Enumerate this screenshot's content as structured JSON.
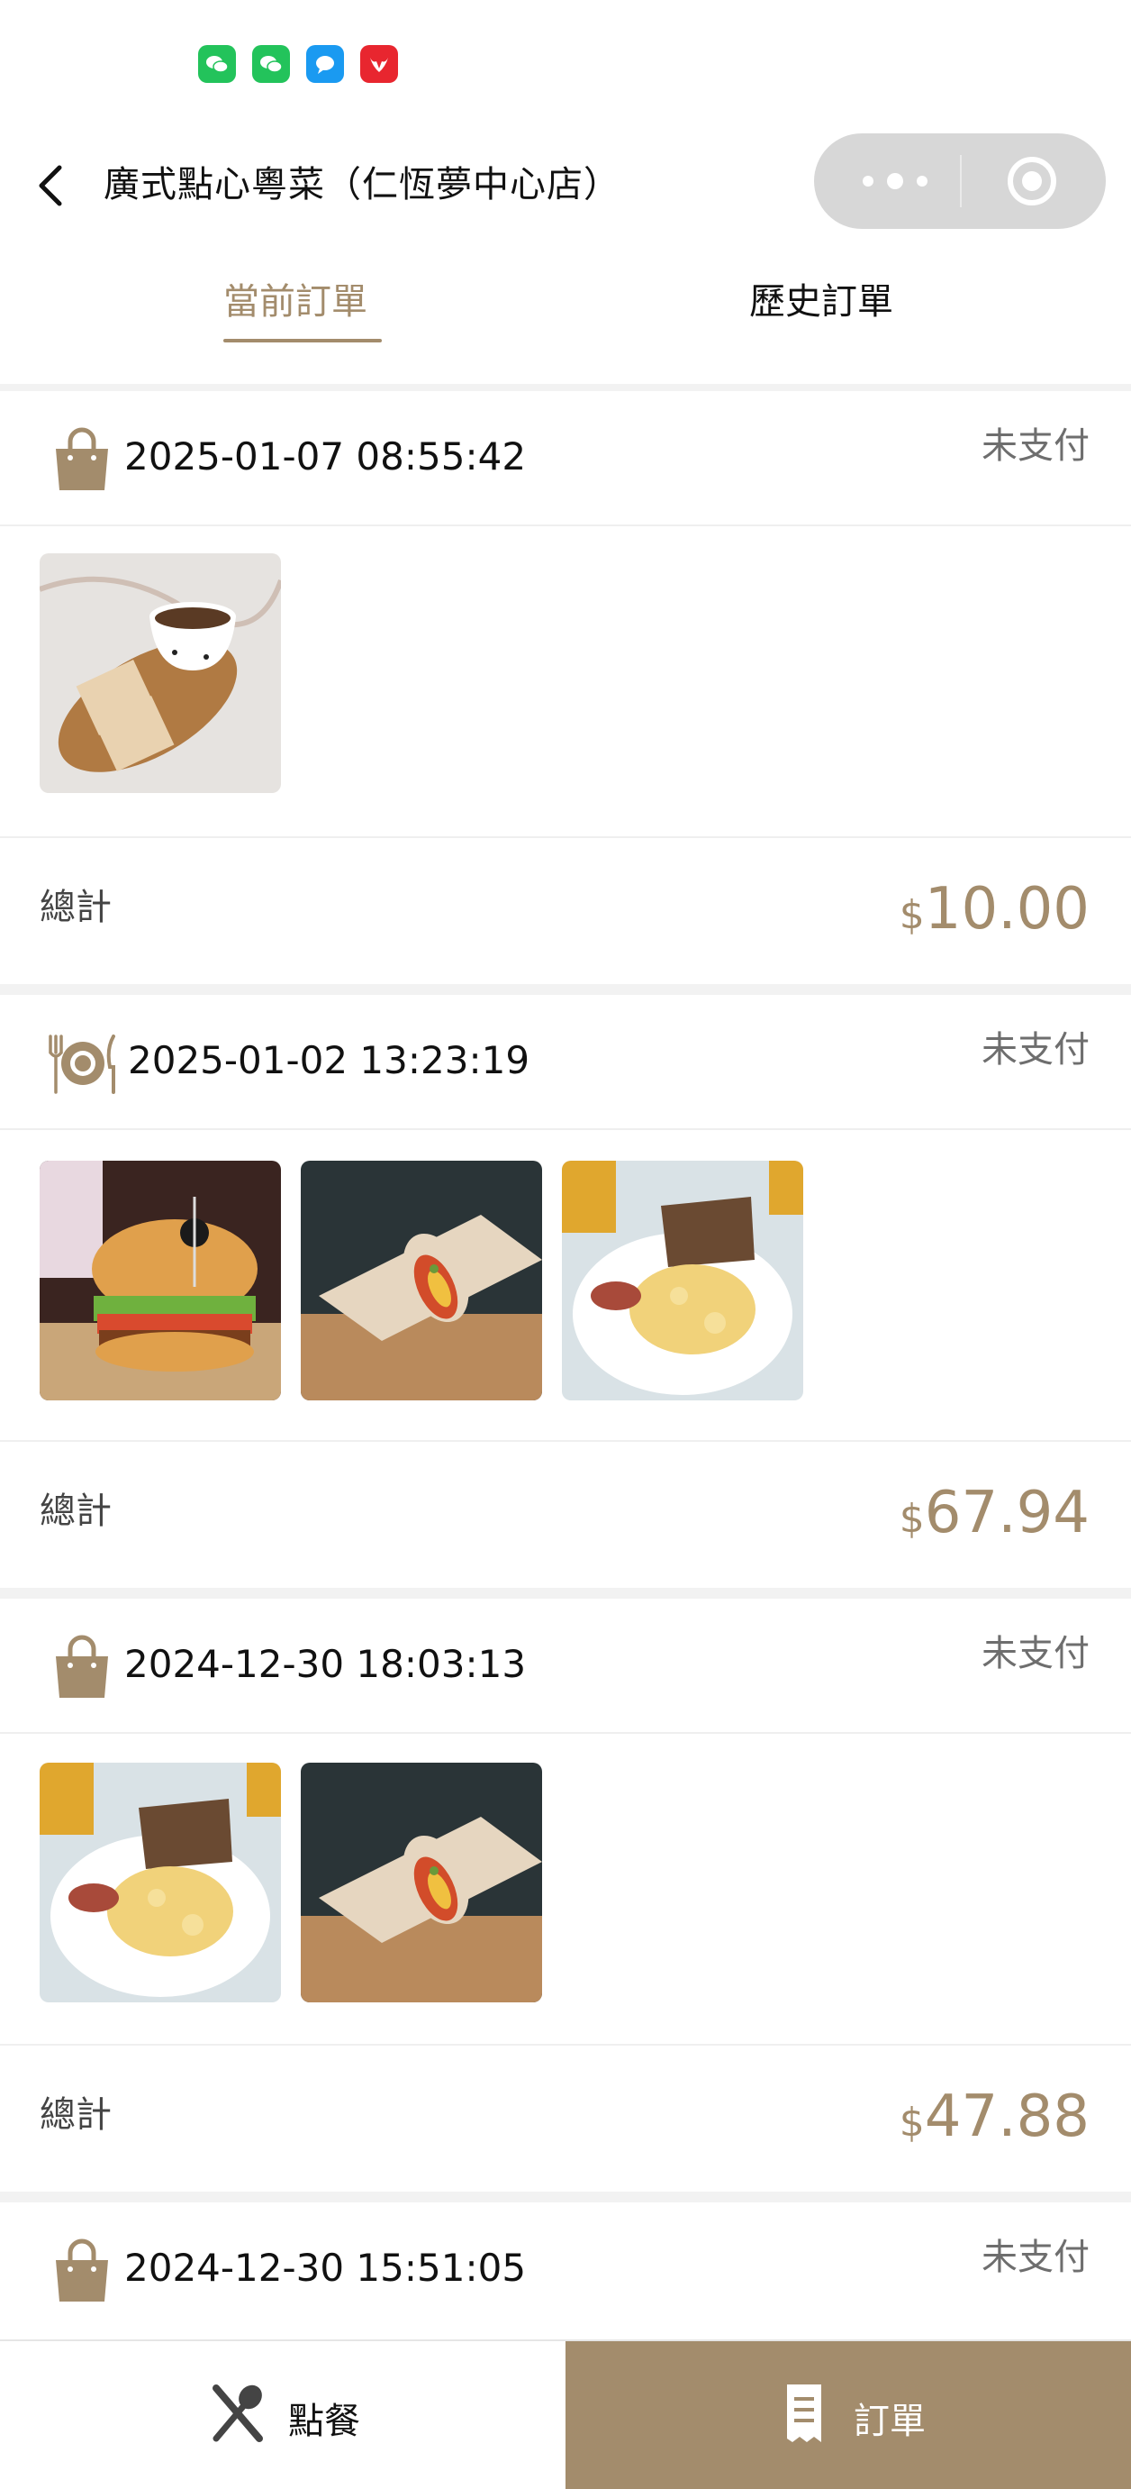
{
  "status_icons": [
    "wechat-icon",
    "wechat-icon",
    "message-icon",
    "bull-app-icon"
  ],
  "header": {
    "title": "廣式點心粵菜（仁恆夢中心店）",
    "menu_icon": "more-dots-icon",
    "close_icon": "target-icon"
  },
  "tabs": [
    {
      "label": "當前訂單",
      "active": true
    },
    {
      "label": "歷史訂單",
      "active": false
    }
  ],
  "orders": [
    {
      "type_icon": "shopping-bag-icon",
      "datetime": "2025-01-07 08:55:42",
      "status": "未支付",
      "items": [
        "coffee-and-toast"
      ],
      "total_label": "總計",
      "currency": "$",
      "amount": "10.00"
    },
    {
      "type_icon": "dine-in-icon",
      "datetime": "2025-01-02 13:23:19",
      "status": "未支付",
      "items": [
        "burger",
        "wrap",
        "scrambled-eggs"
      ],
      "total_label": "總計",
      "currency": "$",
      "amount": "67.94"
    },
    {
      "type_icon": "shopping-bag-icon",
      "datetime": "2024-12-30 18:03:13",
      "status": "未支付",
      "items": [
        "scrambled-eggs",
        "wrap"
      ],
      "total_label": "總計",
      "currency": "$",
      "amount": "47.88"
    },
    {
      "type_icon": "shopping-bag-icon",
      "datetime": "2024-12-30 15:51:05",
      "status": "未支付"
    }
  ],
  "bottom_nav": [
    {
      "label": "點餐",
      "icon": "utensils-icon",
      "active": false
    },
    {
      "label": "訂單",
      "icon": "receipt-icon",
      "active": true
    }
  ],
  "colors": {
    "accent": "#a38c6c",
    "status_text": "#6e6e6e"
  }
}
